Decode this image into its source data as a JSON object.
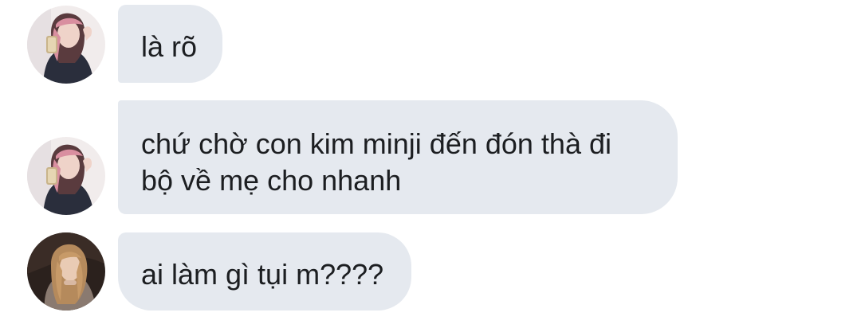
{
  "conversation": {
    "messages": [
      {
        "sender_avatar": "avatar-girl-pink-hair",
        "text": "là rõ"
      },
      {
        "sender_avatar": "avatar-girl-pink-hair",
        "text": "chứ chờ con kim minji đến đón thà đi\nbộ về mẹ cho nhanh"
      },
      {
        "sender_avatar": "avatar-girl-long-hair",
        "text": "ai làm gì tụi m????"
      }
    ]
  },
  "colors": {
    "background": "#ffffff",
    "bubble": "#e5e9ef",
    "text": "#1c1e21"
  }
}
